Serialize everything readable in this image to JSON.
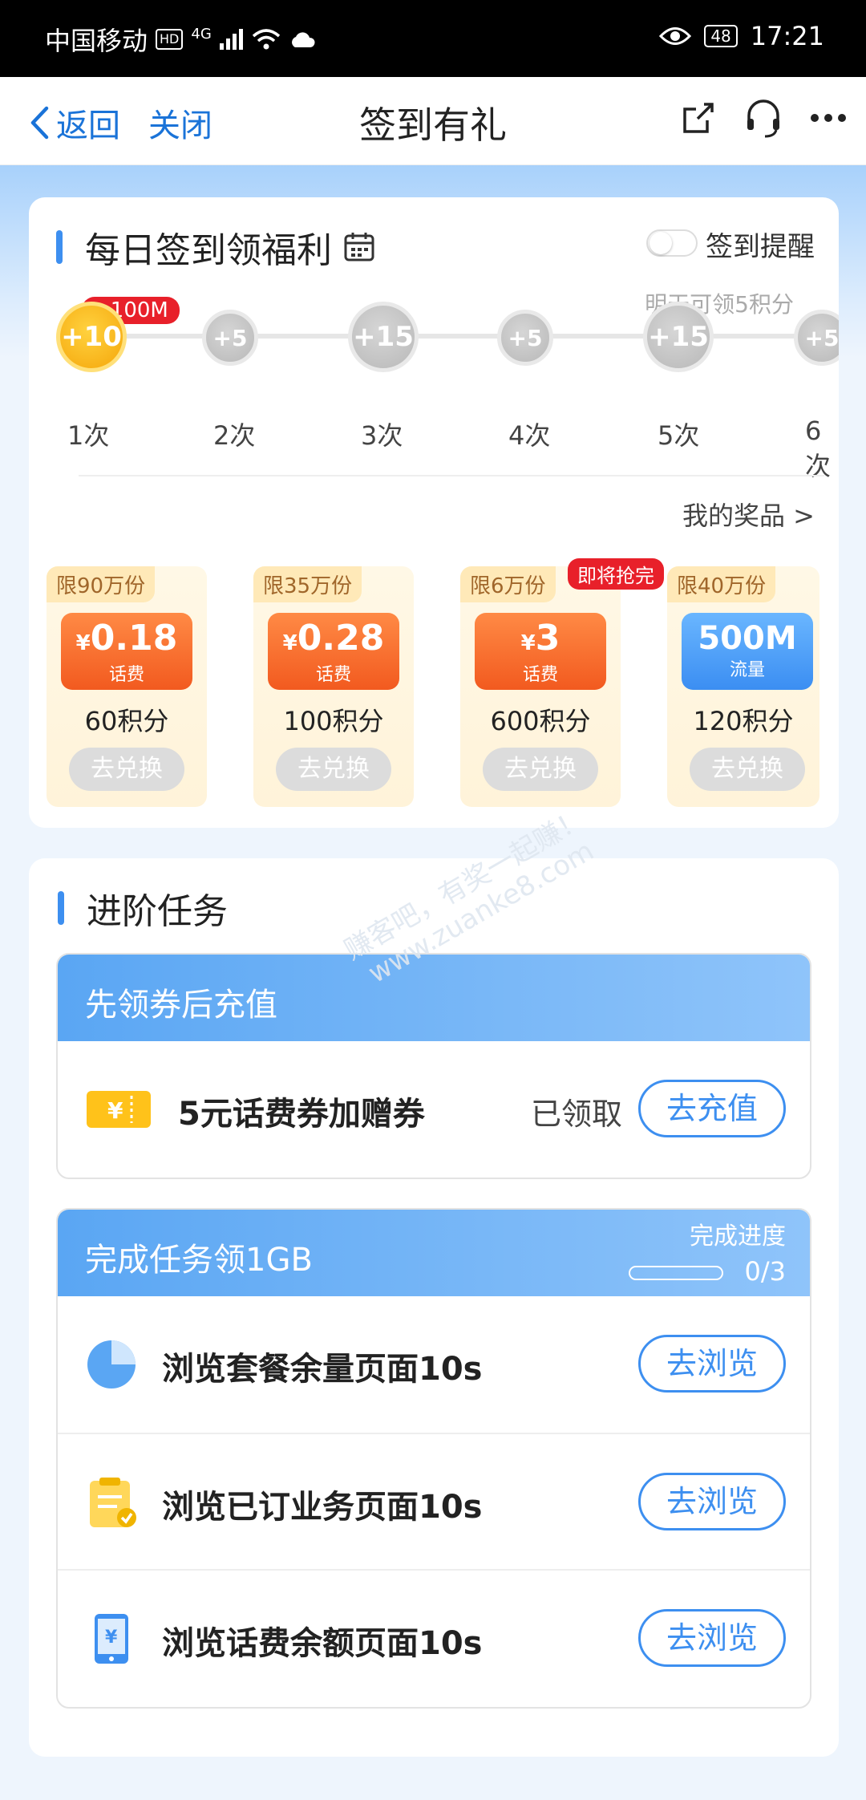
{
  "status": {
    "carrier": "中国移动",
    "hd": "HD",
    "net": "4G",
    "battery": "48",
    "time": "17:21"
  },
  "nav": {
    "back": "返回",
    "close": "关闭",
    "title": "签到有礼"
  },
  "signin": {
    "title": "每日签到领福利",
    "remind_label": "签到提醒",
    "remind_on": false,
    "tomorrow": "明天可领5积分",
    "bonus_tag": "+100M",
    "days": [
      {
        "reward": "+10",
        "label": "1次",
        "state": "done"
      },
      {
        "reward": "+5",
        "label": "2次",
        "state": "todo"
      },
      {
        "reward": "+15",
        "label": "3次",
        "state": "todo"
      },
      {
        "reward": "+5",
        "label": "4次",
        "state": "todo"
      },
      {
        "reward": "+15",
        "label": "5次",
        "state": "todo"
      },
      {
        "reward": "+5",
        "label": "6次",
        "state": "todo"
      }
    ],
    "my_prizes": "我的奖品 >",
    "hot_tag": "即将抢完",
    "prizes": [
      {
        "limit": "限90万份",
        "currency": "¥",
        "amount": "0.18",
        "type": "话费",
        "points": "60积分",
        "button": "去兑换"
      },
      {
        "limit": "限35万份",
        "currency": "¥",
        "amount": "0.28",
        "type": "话费",
        "points": "100积分",
        "button": "去兑换"
      },
      {
        "limit": "限6万份",
        "currency": "¥",
        "amount": "3",
        "type": "话费",
        "points": "600积分",
        "button": "去兑换"
      },
      {
        "limit": "限40万份",
        "currency": "",
        "amount": "500M",
        "type": "流量",
        "points": "120积分",
        "button": "去兑换"
      }
    ]
  },
  "advanced": {
    "title": "进阶任务",
    "coupon_box": {
      "header": "先领券后充值",
      "item": "5元话费券加赠券",
      "status": "已领取",
      "button": "去充值"
    },
    "task_box": {
      "header": "完成任务领1GB",
      "progress_label": "完成进度",
      "progress_text": "0/3",
      "progress_value": 0,
      "tasks": [
        {
          "label": "浏览套餐余量页面10s",
          "button": "去浏览",
          "icon": "pie-chart-icon"
        },
        {
          "label": "浏览已订业务页面10s",
          "button": "去浏览",
          "icon": "clipboard-icon"
        },
        {
          "label": "浏览话费余额页面10s",
          "button": "去浏览",
          "icon": "phone-yen-icon"
        }
      ]
    }
  },
  "watermark": {
    "line1": "赚客吧，有奖一起赚！",
    "line2": "www.zuanke8.com"
  }
}
